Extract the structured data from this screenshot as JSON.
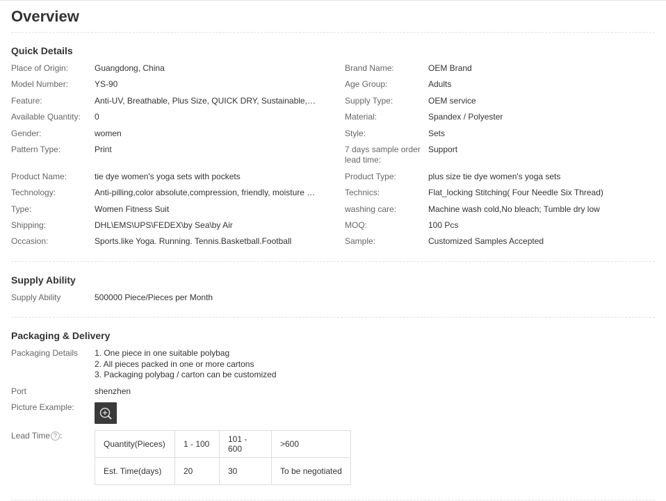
{
  "title": "Overview",
  "quick_details": {
    "heading": "Quick Details",
    "left": [
      {
        "label": "Place of Origin:",
        "value": "Guangdong, China"
      },
      {
        "label": "Model Number:",
        "value": "YS-90"
      },
      {
        "label": "Feature:",
        "value": "Anti-UV, Breathable, Plus Size, QUICK DRY, Sustainable, Waterproof"
      },
      {
        "label": "Available Quantity:",
        "value": "0"
      },
      {
        "label": "Gender:",
        "value": "women"
      },
      {
        "label": "Pattern Type:",
        "value": "Print"
      },
      {
        "label": "Product Name:",
        "value": "tie dye women's yoga sets with pockets"
      },
      {
        "label": "Technology:",
        "value": "Anti-pilling,color absolute,compression, friendly, moisture wicking"
      },
      {
        "label": "Type:",
        "value": "Women Fitness Suit"
      },
      {
        "label": "Shipping:",
        "value": "DHL\\EMS\\UPS\\FEDEX\\by Sea\\by Air"
      },
      {
        "label": "Occasion:",
        "value": "Sports.like Yoga. Running. Tennis.Basketball.Football"
      }
    ],
    "right": [
      {
        "label": "Brand Name:",
        "value": "OEM Brand"
      },
      {
        "label": "Age Group:",
        "value": "Adults"
      },
      {
        "label": "Supply Type:",
        "value": "OEM service"
      },
      {
        "label": "Material:",
        "value": "Spandex / Polyester"
      },
      {
        "label": "Style:",
        "value": "Sets"
      },
      {
        "label": "7 days sample order lead time:",
        "value": "Support"
      },
      {
        "label": "Product Type:",
        "value": "plus size tie dye women's yoga sets"
      },
      {
        "label": "Technics:",
        "value": "Flat_locking Stitching( Four Needle Six Thread)"
      },
      {
        "label": "washing care:",
        "value": "Machine wash cold,No bleach; Tumble dry low"
      },
      {
        "label": "MOQ:",
        "value": "100 Pcs"
      },
      {
        "label": "Sample:",
        "value": "Customized Samples Accepted"
      }
    ]
  },
  "supply_ability": {
    "heading": "Supply Ability",
    "label": "Supply Ability",
    "value": "500000 Piece/Pieces per Month"
  },
  "packaging": {
    "heading": "Packaging & Delivery",
    "details_label": "Packaging Details",
    "details_lines": [
      "1. One piece in one suitable polybag",
      "2. All pieces packed in one or more cartons",
      "3. Packaging polybag / carton can be customized"
    ],
    "port_label": "Port",
    "port_value": "shenzhen",
    "picture_label": "Picture Example:",
    "picture_icon": "zoom-in-icon",
    "lead_time_label": "Lead Time",
    "help_icon": "question-circle-icon",
    "lead_table": {
      "row1": [
        "Quantity(Pieces)",
        "1 - 100",
        "101 - 600",
        ">600"
      ],
      "row2": [
        "Est. Time(days)",
        "20",
        "30",
        "To be negotiated"
      ]
    }
  }
}
